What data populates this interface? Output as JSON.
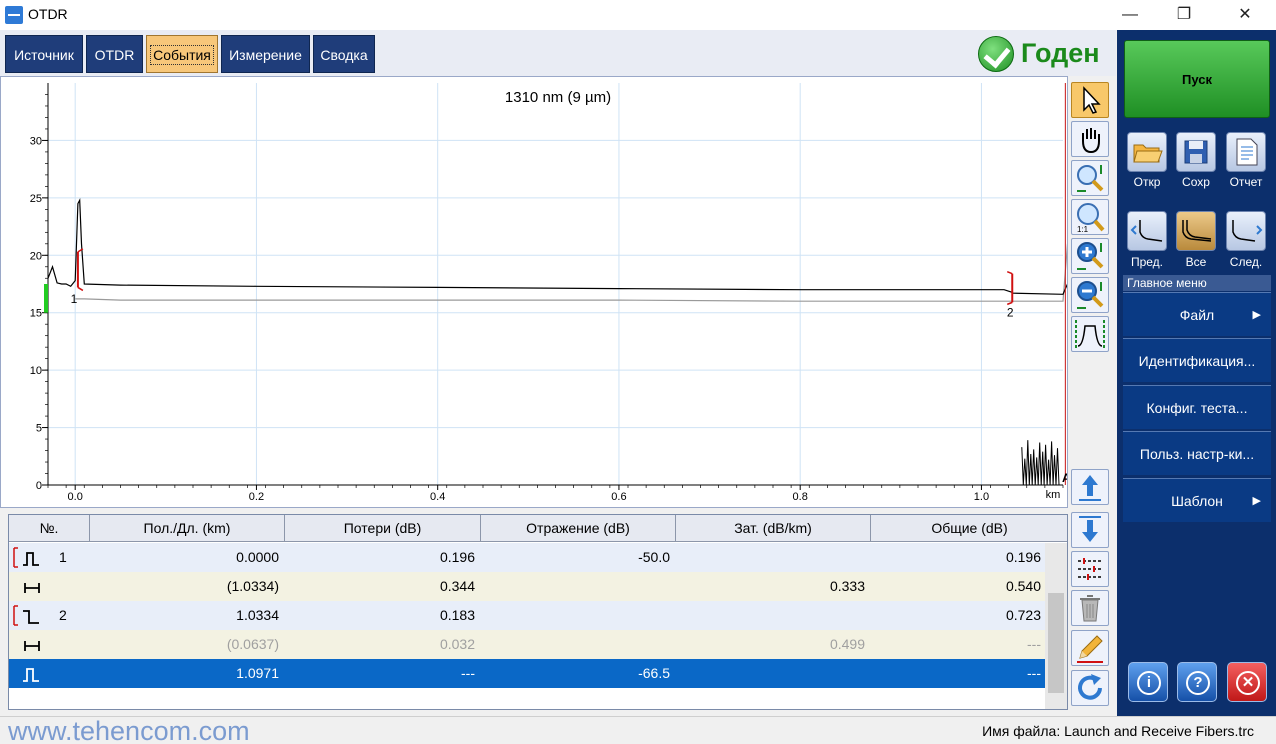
{
  "window": {
    "title": "OTDR",
    "controls": [
      "—",
      "❐",
      "✕"
    ]
  },
  "tabs": [
    {
      "label": "Источник",
      "active": false
    },
    {
      "label": "OTDR",
      "active": false
    },
    {
      "label": "События",
      "active": true
    },
    {
      "label": "Измерение",
      "active": false
    },
    {
      "label": "Сводка",
      "active": false
    }
  ],
  "status": {
    "label": "Годен",
    "color": "#1b8a1b"
  },
  "chart": {
    "title": "1310 nm (9 µm)",
    "x_unit": "km",
    "marker_label": "A",
    "event_labels": [
      "1",
      "2"
    ]
  },
  "chart_data": {
    "type": "line",
    "title": "1310 nm (9 µm)",
    "xlabel": "km",
    "ylabel": "",
    "xlim": [
      -0.03,
      1.09
    ],
    "ylim": [
      0,
      35
    ],
    "xticks": [
      "0.0",
      "0.2",
      "0.4",
      "0.6",
      "0.8",
      "1.0"
    ],
    "yticks": [
      "0",
      "5",
      "10",
      "15",
      "20",
      "25",
      "30"
    ],
    "grid": true,
    "marker_A_km": 1.097,
    "series": [
      {
        "color": "#000000",
        "x": [
          -0.03,
          -0.025,
          -0.02,
          -0.015,
          -0.01,
          -0.005,
          0.0,
          0.003,
          0.005,
          0.007,
          0.01,
          0.05,
          0.2,
          0.4,
          0.6,
          0.8,
          1.0,
          1.025,
          1.033,
          1.035,
          1.09,
          1.095,
          1.097,
          1.1,
          1.102,
          1.104,
          1.106
        ],
        "y": [
          18.0,
          19.0,
          17.6,
          17.5,
          17.5,
          17.3,
          17.8,
          24.5,
          24.8,
          21.0,
          17.5,
          17.4,
          17.3,
          17.2,
          17.1,
          17.0,
          17.0,
          17.0,
          16.8,
          16.7,
          16.6,
          17.5,
          15.0,
          6.0,
          0.5,
          0.3,
          0.0
        ]
      },
      {
        "color": "#9a9a9a",
        "x": [
          0.0,
          0.01,
          0.05,
          0.2,
          0.4,
          0.6,
          0.8,
          1.0,
          1.03,
          1.09,
          1.095,
          1.1,
          1.106
        ],
        "y": [
          16.2,
          16.2,
          16.1,
          16.1,
          16.1,
          16.1,
          16.0,
          16.0,
          16.0,
          16.0,
          21.0,
          8.0,
          0.0
        ]
      }
    ]
  },
  "table": {
    "headers": [
      "№.",
      "Пол./Дл. (km)",
      "Потери (dB)",
      "Отражение (dB)",
      "Зат. (dB/km)",
      "Общие (dB)"
    ],
    "rows": [
      {
        "icon": "reflective-event-icon",
        "num": "1",
        "pos": "0.0000",
        "loss": "0.196",
        "refl": "-50.0",
        "att": "",
        "total": "0.196",
        "style": "row-a"
      },
      {
        "icon": "span-icon",
        "num": "",
        "pos": "(1.0334)",
        "loss": "0.344",
        "refl": "",
        "att": "0.333",
        "total": "0.540",
        "style": "row-b"
      },
      {
        "icon": "nonreflective-event-icon",
        "num": "2",
        "pos": "1.0334",
        "loss": "0.183",
        "refl": "",
        "att": "",
        "total": "0.723",
        "style": "row-a"
      },
      {
        "icon": "span-icon",
        "num": "",
        "pos": "(0.0637)",
        "loss": "0.032",
        "refl": "",
        "att": "0.499",
        "total": "---",
        "style": "row-b dim"
      },
      {
        "icon": "end-event-icon",
        "num": "",
        "pos": "1.0971",
        "loss": "---",
        "refl": "-66.5",
        "att": "",
        "total": "---",
        "style": "row-sel"
      }
    ]
  },
  "sidebar": {
    "start_label": "Пуск",
    "file_buttons": [
      {
        "label": "Откр",
        "icon": "open-folder-icon"
      },
      {
        "label": "Сохр",
        "icon": "save-disk-icon"
      },
      {
        "label": "Отчет",
        "icon": "report-icon"
      }
    ],
    "trace_buttons": [
      {
        "label": "Пред.",
        "icon": "prev-trace-icon"
      },
      {
        "label": "Все",
        "icon": "all-traces-icon"
      },
      {
        "label": "След.",
        "icon": "next-trace-icon"
      }
    ],
    "menu_title": "Главное меню",
    "menu_items": [
      {
        "label": "Файл",
        "arrow": "▶"
      },
      {
        "label": "Идентификация...",
        "arrow": ""
      },
      {
        "label": "Конфиг. теста...",
        "arrow": ""
      },
      {
        "label": "Польз. настр-ки...",
        "arrow": ""
      },
      {
        "label": "Шаблон",
        "arrow": "▶"
      }
    ],
    "bottom_buttons": [
      {
        "icon": "info-icon",
        "glyph": "i"
      },
      {
        "icon": "help-icon",
        "glyph": "?"
      },
      {
        "icon": "close-app-icon",
        "glyph": "✕"
      }
    ]
  },
  "statusbar": {
    "watermark": "www.tehencom.com",
    "filename": "Имя файла: Launch and Receive Fibers.trc"
  }
}
